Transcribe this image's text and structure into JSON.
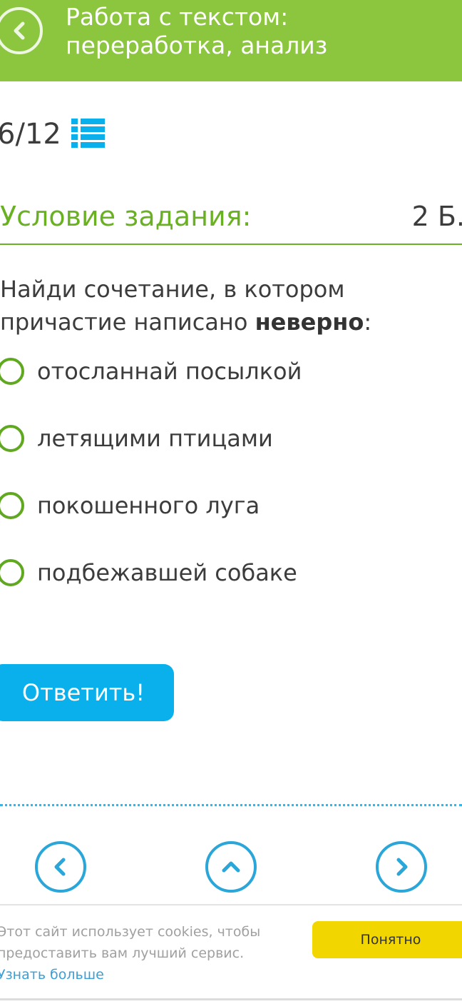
{
  "header": {
    "title": "Работа с текстом: переработка, анализ",
    "back_icon": "chevron-left-icon",
    "color": "#8cc63f"
  },
  "progress": {
    "text": "6/12",
    "list_icon": "list-icon"
  },
  "task": {
    "title": "Условие задания:",
    "points": "2 Б.",
    "question_start": "Найди сочетание, в котором причастие написано ",
    "question_bold": "неверно",
    "question_end": ":"
  },
  "options": [
    "отосланнай посылкой",
    "летящими птицами",
    "покошенного луга",
    "подбежавшей собаке"
  ],
  "answer_button": "Ответить!",
  "navigation": {
    "prev_icon": "chevron-left-icon",
    "up_icon": "chevron-up-icon",
    "next_icon": "chevron-right-icon"
  },
  "cookie": {
    "text": "Этот сайт использует cookies, чтобы предоставить вам лучший сервис. ",
    "link": "Узнать больше",
    "button": "Понятно"
  },
  "colors": {
    "green": "#8cc63f",
    "accent_green": "#6ab023",
    "blue": "#0ab0ec",
    "yellow": "#f2d600"
  }
}
